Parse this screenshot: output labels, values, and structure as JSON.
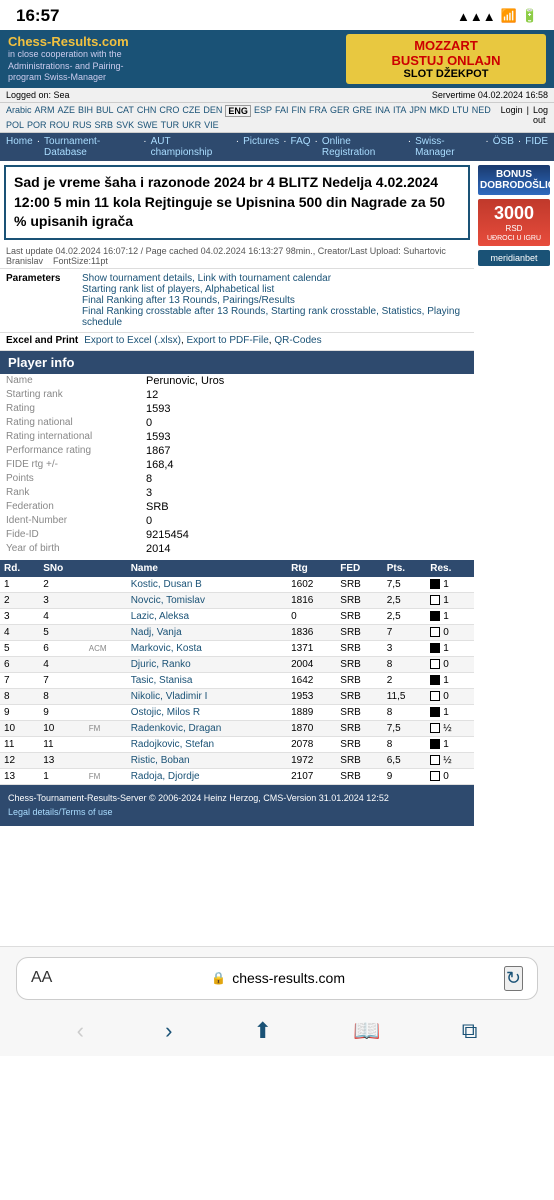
{
  "statusBar": {
    "time": "16:57",
    "signal": "▲▲▲",
    "wifi": "WiFi",
    "battery": "Battery"
  },
  "header": {
    "logo": "Chess-Results.com",
    "logoSub": "in close cooperation with the\nAdministrations- and Pairing-\nprogram Swiss-Manager",
    "ad": {
      "title": "BUSTUJ ONLAJN",
      "subtitle": "SLOT DŽEKPOT",
      "brand": "MOZZART"
    }
  },
  "servertime": "Servertime 04.02.2024 16:58",
  "loggedOn": "Logged on: Sea",
  "langBar": {
    "langs": [
      "Arabic",
      "ARM",
      "AZE",
      "BIH",
      "BUL",
      "CAT",
      "CHN",
      "CRO",
      "CZE",
      "DEN",
      "ENG",
      "ESP",
      "FAI",
      "FIN",
      "FRA",
      "GER",
      "GRE",
      "INA",
      "ITA",
      "JPN",
      "MKD",
      "LTU",
      "NED",
      "POL",
      "POR",
      "ROU",
      "RUS",
      "SRB",
      "SVK",
      "SWE",
      "TUR",
      "UKR",
      "VIE"
    ],
    "activeLang": "ENG",
    "loginLinks": [
      "Login",
      "Log out"
    ]
  },
  "breadcrumb": {
    "items": [
      "Home",
      "Tournament-Database",
      "AUT championship",
      "Pictures",
      "FAQ",
      "Online Registration",
      "Swiss-Manager",
      "ÖSB",
      "FIDE"
    ]
  },
  "tournamentTitle": "Sad je vreme šaha i razonode 2024 br 4 BLITZ Nedelja 4.02.2024 12:00 5 min 11 kola Rejtinguje se Upisnina 500 din Nagrade za 50 % upisanih igrača",
  "metaInfo": "Last update 04.02.2024 16:07:12 / Page cached 04.02.2024 16:13:27 98min., Creator/Last Upload: Suhartovic Branislav",
  "fontSizeNote": "FontSize:11pt",
  "parameters": {
    "label": "Parameters",
    "links": [
      "Show tournament details",
      "Link with tournament calendar",
      "Starting rank list of players",
      "Alphabetical list",
      "Final Ranking after 13 Rounds",
      "Pairings/Results",
      "Final Ranking crosstable after 13 Rounds",
      "Starting rank crosstable",
      "Statistics",
      "Playing schedule"
    ]
  },
  "excelPrint": {
    "label": "Excel and Print",
    "links": [
      "Export to Excel (.xlsx)",
      "Export to PDF-File",
      "QR-Codes"
    ]
  },
  "playerInfo": {
    "title": "Player info",
    "fields": [
      {
        "label": "Name",
        "value": "Perunovic, Uros"
      },
      {
        "label": "Starting rank",
        "value": "12"
      },
      {
        "label": "Rating",
        "value": "1593"
      },
      {
        "label": "Rating national",
        "value": "0"
      },
      {
        "label": "Rating international",
        "value": "1593"
      },
      {
        "label": "Performance rating",
        "value": "1867"
      },
      {
        "label": "FIDE rtg +/-",
        "value": "168,4"
      },
      {
        "label": "Points",
        "value": "8"
      },
      {
        "label": "Rank",
        "value": "3"
      },
      {
        "label": "Federation",
        "value": "SRB"
      },
      {
        "label": "Ident-Number",
        "value": "0"
      },
      {
        "label": "Fide-ID",
        "value": "9215454"
      },
      {
        "label": "Year of birth",
        "value": "2014"
      }
    ]
  },
  "resultsTable": {
    "columns": [
      "Rd.",
      "SNo",
      "",
      "Name",
      "Rtg",
      "FED",
      "Pts.",
      "Res."
    ],
    "rows": [
      {
        "rd": "1",
        "sno": "2",
        "badge": "",
        "name": "Kostic, Dusan B",
        "rtg": "1602",
        "fed": "SRB",
        "pts": "7,5",
        "color": "black",
        "res": "1"
      },
      {
        "rd": "2",
        "sno": "3",
        "badge": "",
        "name": "Novcic, Tomislav",
        "rtg": "1816",
        "fed": "SRB",
        "pts": "2,5",
        "color": "white",
        "res": "1"
      },
      {
        "rd": "3",
        "sno": "4",
        "badge": "",
        "name": "Lazic, Aleksa",
        "rtg": "0",
        "fed": "SRB",
        "pts": "2,5",
        "color": "black",
        "res": "1"
      },
      {
        "rd": "4",
        "sno": "5",
        "badge": "",
        "name": "Nadj, Vanja",
        "rtg": "1836",
        "fed": "SRB",
        "pts": "7",
        "color": "white",
        "res": "0"
      },
      {
        "rd": "5",
        "sno": "6",
        "badge": "ACM",
        "name": "Markovic, Kosta",
        "rtg": "1371",
        "fed": "SRB",
        "pts": "3",
        "color": "black",
        "res": "1"
      },
      {
        "rd": "6",
        "sno": "4",
        "badge": "",
        "name": "Djuric, Ranko",
        "rtg": "2004",
        "fed": "SRB",
        "pts": "8",
        "color": "white",
        "res": "0"
      },
      {
        "rd": "7",
        "sno": "7",
        "badge": "",
        "name": "Tasic, Stanisa",
        "rtg": "1642",
        "fed": "SRB",
        "pts": "2",
        "color": "black",
        "res": "1"
      },
      {
        "rd": "8",
        "sno": "8",
        "badge": "",
        "name": "Nikolic, Vladimir I",
        "rtg": "1953",
        "fed": "SRB",
        "pts": "11,5",
        "color": "white",
        "res": "0"
      },
      {
        "rd": "9",
        "sno": "9",
        "badge": "",
        "name": "Ostojic, Milos R",
        "rtg": "1889",
        "fed": "SRB",
        "pts": "8",
        "color": "black",
        "res": "1"
      },
      {
        "rd": "10",
        "sno": "10",
        "badge": "FM",
        "name": "Radenkovic, Dragan",
        "rtg": "1870",
        "fed": "SRB",
        "pts": "7,5",
        "color": "white",
        "res": "½"
      },
      {
        "rd": "11",
        "sno": "11",
        "badge": "",
        "name": "Radojkovic, Stefan",
        "rtg": "2078",
        "fed": "SRB",
        "pts": "8",
        "color": "black",
        "res": "1"
      },
      {
        "rd": "12",
        "sno": "13",
        "badge": "",
        "name": "Ristic, Boban",
        "rtg": "1972",
        "fed": "SRB",
        "pts": "6,5",
        "color": "white",
        "res": "½"
      },
      {
        "rd": "13",
        "sno": "1",
        "badge": "FM",
        "name": "Radoja, Djordje",
        "rtg": "2107",
        "fed": "SRB",
        "pts": "9",
        "color": "white",
        "res": "0"
      }
    ]
  },
  "footer": {
    "text": "Chess-Tournament-Results-Server © 2006-2024 Heinz Herzog, CMS-Version 31.01.2024 12:52",
    "link": "Legal details/Terms of use"
  },
  "adSide1": {
    "label": "BONUS DOBRODOŠLICE"
  },
  "adSide2": {
    "amount": "3000",
    "currency": "RSD",
    "cta": "UĐROCI U IGRU"
  },
  "adSide3": {
    "brand": "meridianbet"
  },
  "browser": {
    "aaLabel": "AA",
    "url": "chess-results.com"
  }
}
